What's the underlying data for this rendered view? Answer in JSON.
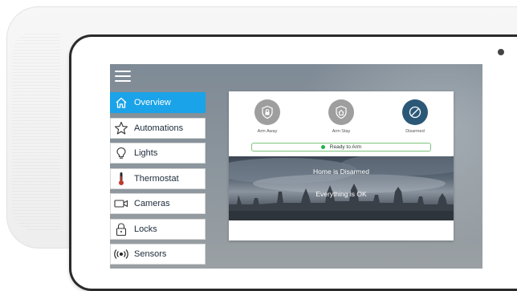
{
  "colors": {
    "accent": "#1aa3e8",
    "mode_inactive": "#9e9e9e",
    "mode_active": "#2c5877",
    "ready_green": "#1db54a"
  },
  "icons": {
    "menu": "hamburger-menu-icon",
    "overview": "house-icon",
    "automations": "star-icon",
    "lights": "lightbulb-icon",
    "thermostat": "thermometer-icon",
    "cameras": "camera-icon",
    "locks": "padlock-icon",
    "sensors": "wireless-signal-icon"
  },
  "sidebar": {
    "items": [
      {
        "label": "Overview",
        "active": true
      },
      {
        "label": "Automations",
        "active": false
      },
      {
        "label": "Lights",
        "active": false
      },
      {
        "label": "Thermostat",
        "active": false
      },
      {
        "label": "Cameras",
        "active": false
      },
      {
        "label": "Locks",
        "active": false
      },
      {
        "label": "Sensors",
        "active": false
      }
    ]
  },
  "security": {
    "modes": [
      {
        "label": "Arm Away",
        "selected": false
      },
      {
        "label": "Arm Stay",
        "selected": false
      },
      {
        "label": "Disarmed",
        "selected": true
      }
    ],
    "status": "Ready to Arm",
    "headline": "Home is Disarmed",
    "subline": "Everything is OK"
  }
}
